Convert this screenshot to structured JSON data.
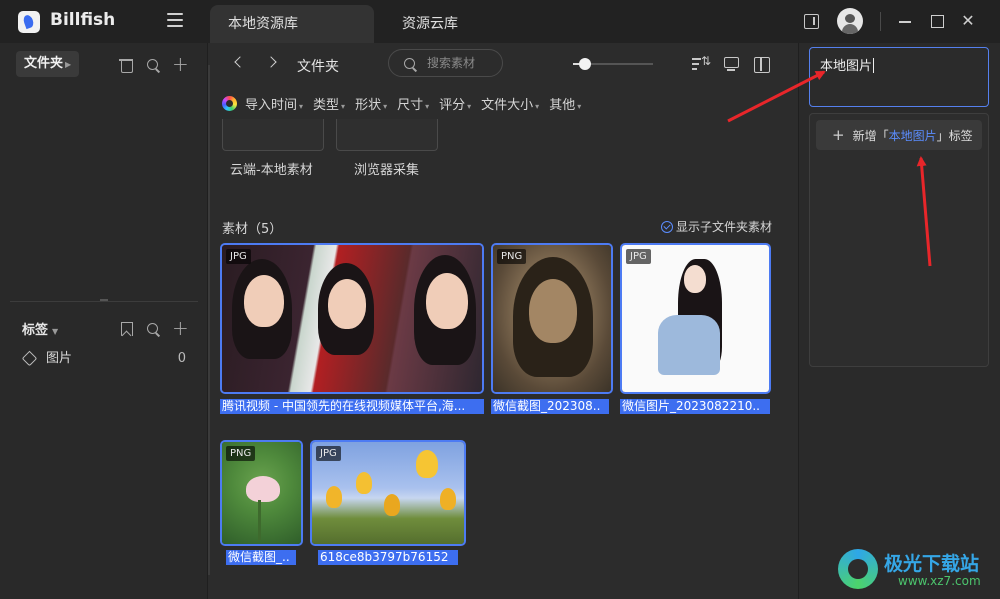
{
  "app": {
    "name": "Billfish"
  },
  "tabs": [
    {
      "label": "本地资源库",
      "active": true
    },
    {
      "label": "资源云库",
      "active": false
    }
  ],
  "sidebar": {
    "folder_header": "文件夹",
    "tags_header": "标签",
    "tags": [
      {
        "label": "图片",
        "count": "0"
      }
    ]
  },
  "toolbar": {
    "breadcrumb": "文件夹",
    "search_placeholder": "搜索素材",
    "zoom_level": 0.15
  },
  "filters": [
    "导入时间",
    "类型",
    "形状",
    "尺寸",
    "评分",
    "文件大小",
    "其他"
  ],
  "folders": [
    "云端-本地素材",
    "浏览器采集"
  ],
  "assets_section": {
    "title": "素材（5）",
    "subfolder_toggle": "显示子文件夹素材"
  },
  "assets": [
    {
      "type": "JPG",
      "name": "腾讯视频 - 中国领先的在线视频媒体平台,海..."
    },
    {
      "type": "PNG",
      "name": "微信截图_202308.."
    },
    {
      "type": "JPG",
      "name": "微信图片_2023082210.."
    },
    {
      "type": "PNG",
      "name": "微信截图_.."
    },
    {
      "type": "JPG",
      "name": "618ce8b3797b76152"
    }
  ],
  "tag_panel": {
    "input_value": "本地图片",
    "option_prefix": "新增「",
    "option_highlight": "本地图片",
    "option_suffix": "」标签"
  },
  "watermark": {
    "title": "极光下载站",
    "url": "www.xz7.com"
  },
  "colors": {
    "accent": "#4d7bf3",
    "annotation_arrow": "#e8262a"
  }
}
